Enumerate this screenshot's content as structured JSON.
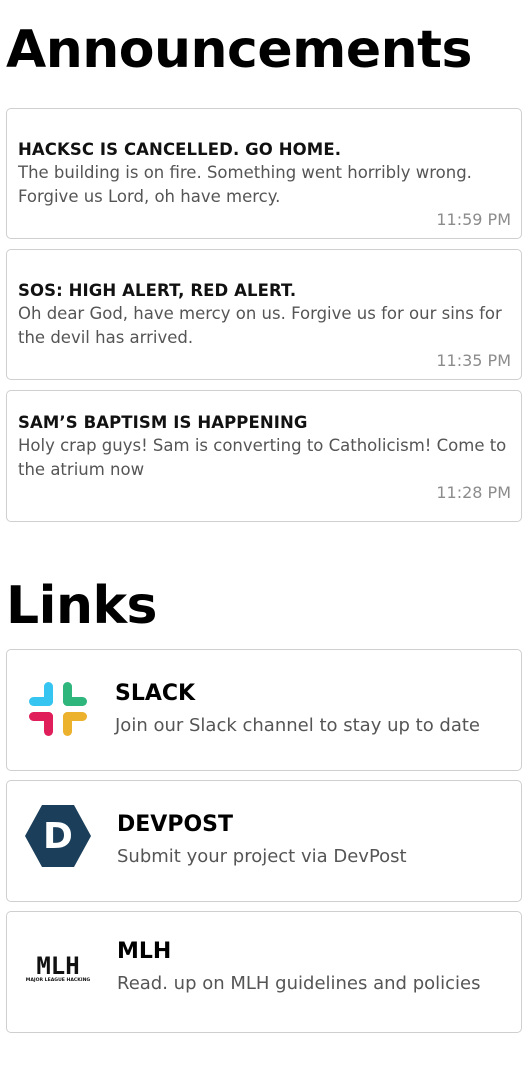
{
  "announcements": {
    "heading": "Announcements",
    "items": [
      {
        "title": "HACKSC IS CANCELLED. GO HOME.",
        "body": "The building is on fire. Something went horribly wrong. Forgive us Lord, oh have mercy.",
        "time": "11:59 PM"
      },
      {
        "title": "SOS: HIGH ALERT, RED ALERT.",
        "body": "Oh dear God, have mercy on us. Forgive us for our sins for the devil has arrived.",
        "time": "11:35 PM"
      },
      {
        "title": "SAM’S BAPTISM IS HAPPENING",
        "body": "Holy crap guys! Sam is converting to Catholicism! Come to the atrium now",
        "time": "11:28 PM"
      }
    ]
  },
  "links": {
    "heading": "Links",
    "items": [
      {
        "title": "SLACK",
        "description": "Join our Slack channel to stay up to date",
        "icon": "slack-logo-icon"
      },
      {
        "title": "DEVPOST",
        "description": "Submit your project via DevPost",
        "icon": "devpost-logo-icon",
        "icon_letter": "D",
        "icon_color": "#1b3f5a"
      },
      {
        "title": "MLH",
        "description": "Read. up on MLH guidelines and policies",
        "icon": "mlh-logo-icon",
        "icon_text": "MLH",
        "icon_subtext": "MAJOR LEAGUE HACKING"
      }
    ]
  },
  "colors": {
    "slack_blue": "#36c5f0",
    "slack_green": "#2eb67d",
    "slack_yellow": "#ecb22e",
    "slack_red": "#e01e5a",
    "devpost_navy": "#1b3f5a",
    "card_border": "#cfcfcf",
    "time_gray": "#8c8c8c"
  }
}
